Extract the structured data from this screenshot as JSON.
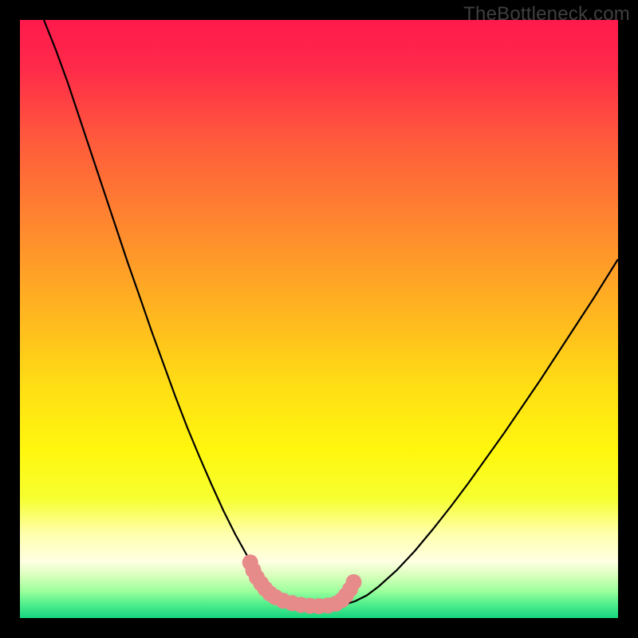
{
  "watermark": "TheBottleneck.com",
  "chart_data": {
    "type": "line",
    "title": "",
    "xlabel": "",
    "ylabel": "",
    "xlim": [
      0,
      100
    ],
    "ylim": [
      0,
      100
    ],
    "grid": false,
    "series": [
      {
        "name": "curve",
        "color": "#000000",
        "x": [
          4,
          6,
          8,
          10,
          12,
          14,
          16,
          18,
          20,
          22,
          24,
          26,
          28,
          30,
          32,
          34,
          36,
          38,
          39.5,
          41,
          43,
          45,
          47,
          49,
          51,
          52.5,
          54,
          56,
          58,
          60,
          63,
          66,
          69,
          72,
          75,
          78,
          81,
          84,
          87,
          90,
          93,
          96,
          99,
          100
        ],
        "y": [
          100,
          95,
          89.5,
          83.5,
          77.5,
          71.5,
          65.5,
          59.5,
          53.8,
          48,
          42.5,
          37,
          31.8,
          27,
          22.4,
          18,
          14,
          10.4,
          8,
          6,
          4.3,
          3.2,
          2.5,
          2.1,
          2.0,
          2.05,
          2.2,
          2.8,
          3.8,
          5.3,
          8.0,
          11.2,
          14.8,
          18.6,
          22.6,
          26.8,
          31.0,
          35.4,
          39.8,
          44.4,
          49.0,
          53.6,
          58.4,
          60
        ]
      },
      {
        "name": "marker-band",
        "color": "#e78a8a",
        "x": [
          38.5,
          39.0,
          39.6,
          40.3,
          41.0,
          41.8,
          42.7,
          44.0,
          45.5,
          47.0,
          48.5,
          50.0,
          51.5,
          52.8,
          53.8,
          54.5,
          55.2,
          55.8
        ],
        "y": [
          9.3,
          8.0,
          6.8,
          5.8,
          4.9,
          4.1,
          3.5,
          2.9,
          2.5,
          2.2,
          2.05,
          2.0,
          2.1,
          2.4,
          3.0,
          3.8,
          4.8,
          6.0
        ]
      }
    ],
    "gradient_stops": [
      {
        "offset": 0.0,
        "color": "#ff1a4d"
      },
      {
        "offset": 0.08,
        "color": "#ff2a4a"
      },
      {
        "offset": 0.2,
        "color": "#ff5a3c"
      },
      {
        "offset": 0.35,
        "color": "#ff8a2e"
      },
      {
        "offset": 0.5,
        "color": "#ffb91f"
      },
      {
        "offset": 0.62,
        "color": "#ffe014"
      },
      {
        "offset": 0.72,
        "color": "#fff70e"
      },
      {
        "offset": 0.8,
        "color": "#f6ff30"
      },
      {
        "offset": 0.86,
        "color": "#ffffae"
      },
      {
        "offset": 0.905,
        "color": "#ffffe2"
      },
      {
        "offset": 0.93,
        "color": "#d6ffba"
      },
      {
        "offset": 0.955,
        "color": "#9cff9c"
      },
      {
        "offset": 0.975,
        "color": "#56f08e"
      },
      {
        "offset": 1.0,
        "color": "#16d67e"
      }
    ]
  }
}
